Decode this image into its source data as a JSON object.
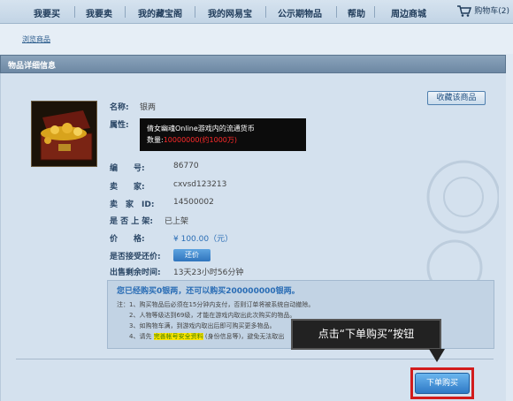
{
  "nav": {
    "items": [
      "我要买",
      "我要卖",
      "我的藏宝阁",
      "我的网易宝",
      "公示期物品",
      "帮助",
      "周边商城"
    ],
    "cart_label": "购物车",
    "cart_count": "(2)"
  },
  "breadcrumb": "浏览商品",
  "panel_title": "物品详细信息",
  "favorite_button": "收藏该商品",
  "item": {
    "name_label": "名称:",
    "name": "银两",
    "attr_label": "属性:",
    "attr_line1": "倩女幽魂Online游戏内的流通货币",
    "attr_qty_label": "数量:",
    "attr_qty": "10000000(约1000万)",
    "id_label": "编　　号:",
    "id": "86770",
    "seller_label": "卖　　家:",
    "seller": "cxvsd123213",
    "seller_id_label": "卖　家　ID:",
    "seller_id": "14500002",
    "listed_label": "是 否 上 架:",
    "listed": "已上架",
    "price_label": "价　　格:",
    "price": "¥ 100.00（元）",
    "offer_label": "是否接受还价:",
    "offer_button": "还价",
    "time_label": "出售剩余时间:",
    "time": "13天23小时56分钟"
  },
  "notice": {
    "title": "您已经购买0银两，还可以购买200000000银两。",
    "items": [
      "注：1、购买物品后必须在15分钟内支付，否则订单将被系统自动撤除。",
      "2、人物等级达到69级，才能在游戏内取出此次购买的物品。",
      "3、如购物车满，到游戏内取出后即可购买更多物品。",
      "4、请先 完善帐号安全资料 (身份信息等)，避免无法取出"
    ],
    "highlight": "完善帐号安全资料"
  },
  "callout": "点击“下单购买”按钮",
  "buy_button": "下单购买",
  "colors": {
    "accent": "#2e79c5",
    "highlight_box": "#d21c1c"
  }
}
